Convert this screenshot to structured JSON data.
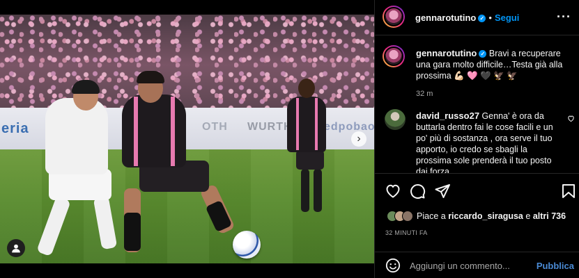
{
  "post": {
    "board_texts": [
      "eria",
      "OTH",
      "WURTH",
      "edpobao"
    ],
    "next_icon": "chevron-right-icon",
    "user_tag_icon": "person-icon"
  },
  "header": {
    "username": "gennarotutino",
    "verified_icon": "verified-badge-icon",
    "separator": "•",
    "follow_label": "Segui",
    "more_icon": "more-horizontal-icon"
  },
  "caption": {
    "username": "gennarotutino",
    "text": "Bravi a recuperare una gara molto difficile…Testa già alla prossima 💪🏻 🩷 🖤 🦅 🦅",
    "time": "32 m"
  },
  "comment": {
    "username": "david_russo27",
    "text": "Genna' è ora da buttarla dentro fai le cose facili e un po' più di sostanza , ora serve il tuo apporto, io credo se sbagli la prossima sole prenderà il tuo posto dai forza"
  },
  "actions": {
    "like_icon": "heart-icon",
    "comment_icon": "comment-icon",
    "share_icon": "share-icon",
    "save_icon": "bookmark-icon"
  },
  "likes": {
    "prefix": "Piace a",
    "user": "riccardo_siragusa",
    "conj": "e",
    "others": "altri 736"
  },
  "timestamp": "32 MINUTI FA",
  "add_comment": {
    "placeholder": "Aggiungi un commento...",
    "publish_label": "Pubblica",
    "emoji_icon": "emoji-icon"
  },
  "colors": {
    "accent": "#0095f6",
    "publish": "#4a8ad4",
    "background": "#000000",
    "muted": "#a8a8a8"
  }
}
